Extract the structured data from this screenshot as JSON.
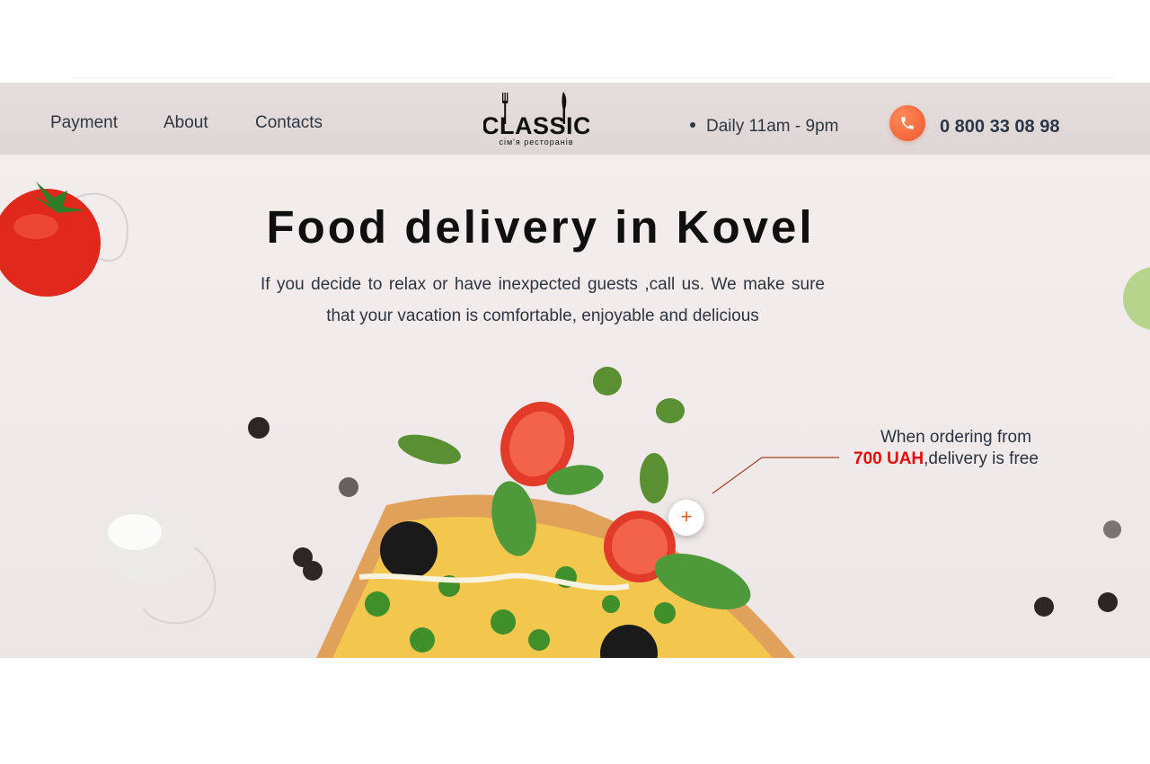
{
  "nav": {
    "payment": "Payment",
    "about": "About",
    "contacts": "Contacts"
  },
  "logo": {
    "name": "CLASSIC",
    "tagline": "сім'я ресторанів"
  },
  "header": {
    "hours": "Daily 11am - 9pm",
    "phone": "0 800 33 08 98",
    "phone_icon": "phone-icon"
  },
  "hero": {
    "title": "Food delivery in Kovel",
    "subtitle": "If you decide to relax or have inexpected guests ,call us. We make sure that your vacation is comfortable, enjoyable and delicious"
  },
  "promo": {
    "line1": "When ordering from",
    "amount": "700 UAH",
    "line2_rest": ",delivery is free",
    "plus": "+"
  },
  "colors": {
    "accent": "#f0562a",
    "promo_amount": "#e60b0b",
    "header_bg": "#e2dbda",
    "hero_bg": "#f0eaea"
  }
}
